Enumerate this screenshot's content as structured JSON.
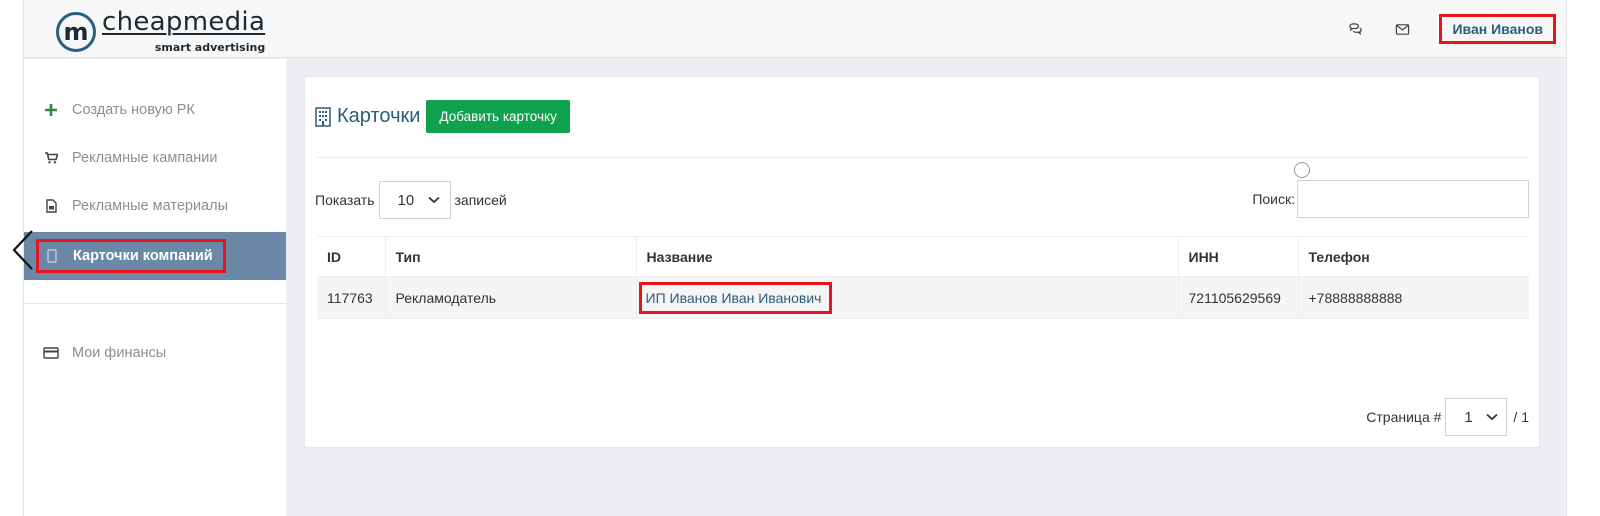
{
  "header": {
    "logo": {
      "mark": "m",
      "name": "cheapmedia",
      "tagline": "smart advertising"
    },
    "icons": [
      "chat-icon",
      "mail-icon"
    ],
    "user_name": "Иван Иванов",
    "highlight_color": "#e8141b"
  },
  "sidebar": {
    "items": [
      {
        "label": "Создать новую РК",
        "icon": "plus-icon"
      },
      {
        "label": "Рекламные кампании",
        "icon": "cart-icon"
      },
      {
        "label": "Рекламные материалы",
        "icon": "document-icon"
      },
      {
        "label": "Карточки компаний",
        "icon": "card-icon",
        "active": true
      },
      {
        "label": "Мои финансы",
        "icon": "credit-card-icon"
      }
    ],
    "active_color": "#6b88a8"
  },
  "main": {
    "title": "Карточки",
    "add_button": "Добавить карточку",
    "show_label": "Показать",
    "page_size": "10",
    "records_label": "записей",
    "search_label": "Поиск:",
    "search_value": "",
    "table": {
      "columns": [
        "ID",
        "Тип",
        "Название",
        "ИНН",
        "Телефон"
      ],
      "rows": [
        [
          "117763",
          "Рекламодатель",
          "ИП Иванов Иван Иванович",
          "721105629569",
          "+78888888888"
        ]
      ]
    },
    "pager": {
      "label": "Страница #",
      "current": "1",
      "total": "/ 1"
    },
    "accent_color": "#2b5d7c",
    "button_color": "#0fa14d"
  }
}
